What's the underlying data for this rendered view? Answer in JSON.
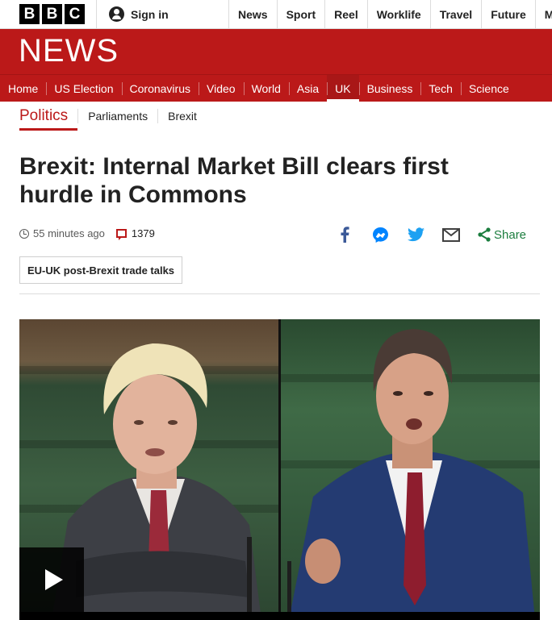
{
  "brand": {
    "logo_letters": [
      "B",
      "B",
      "C"
    ],
    "signin_label": "Sign in",
    "banner_title": "NEWS",
    "colors": {
      "brand_red": "#bb1919",
      "share_green": "#1b7d3e"
    }
  },
  "top_nav": [
    "News",
    "Sport",
    "Reel",
    "Worklife",
    "Travel",
    "Future",
    "Mo"
  ],
  "section_nav": {
    "items": [
      "Home",
      "US Election",
      "Coronavirus",
      "Video",
      "World",
      "Asia",
      "UK",
      "Business",
      "Tech",
      "Science"
    ],
    "active": "UK"
  },
  "sub_nav": {
    "primary": "Politics",
    "items": [
      "Parliaments",
      "Brexit"
    ]
  },
  "article": {
    "headline": "Brexit: Internal Market Bill clears first hurdle in Commons",
    "timestamp": "55 minutes ago",
    "comment_count": "1379",
    "share_label": "Share",
    "share_icons": [
      "facebook-icon",
      "messenger-icon",
      "twitter-icon",
      "email-icon",
      "share-icon"
    ],
    "tag": "EU-UK post-Brexit trade talks"
  },
  "video": {
    "play_icon": "play-icon"
  }
}
